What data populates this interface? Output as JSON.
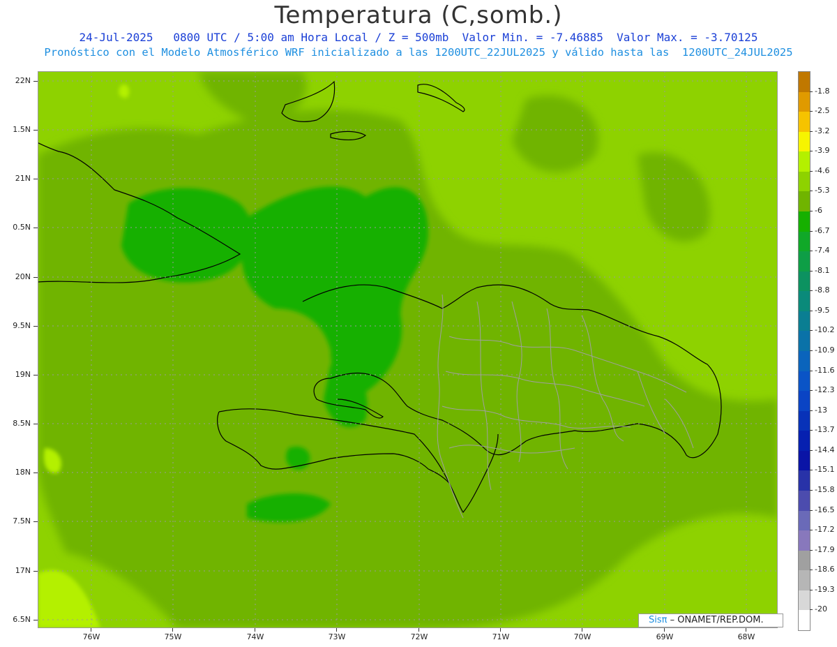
{
  "header": {
    "title": "Temperatura (C,somb.)",
    "line1": "24-Jul-2025   0800 UTC / 5:00 am Hora Local / Z = 500mb  Valor Min. = -7.46885  Valor Max. = -3.70125",
    "line2": "Pronóstico con el Modelo Atmosférico WRF inicializado a las 1200UTC_22JUL2025 y válido hasta las  1200UTC_24JUL2025"
  },
  "axes": {
    "lat_labels": [
      "22N",
      "1.5N",
      "21N",
      "0.5N",
      "20N",
      "9.5N",
      "19N",
      "8.5N",
      "18N",
      "7.5N",
      "17N",
      "6.5N"
    ],
    "lon_labels": [
      "76W",
      "75W",
      "74W",
      "73W",
      "72W",
      "71W",
      "70W",
      "69W",
      "68W"
    ]
  },
  "legend": {
    "labels": [
      "-1.8",
      "-2.5",
      "-3.2",
      "-3.9",
      "-4.6",
      "-5.3",
      "-6",
      "-6.7",
      "-7.4",
      "-8.1",
      "-8.8",
      "-9.5",
      "-10.2",
      "-10.9",
      "-11.6",
      "-12.3",
      "-13",
      "-13.7",
      "-14.4",
      "-15.1",
      "-15.8",
      "-16.5",
      "-17.2",
      "-17.9",
      "-18.6",
      "-19.3",
      "-20"
    ],
    "colors": [
      "#c07800",
      "#e09a00",
      "#f6c300",
      "#f7f400",
      "#b4f000",
      "#8ed200",
      "#70b400",
      "#16b000",
      "#10a828",
      "#0e9e46",
      "#0c9260",
      "#0a8a7a",
      "#0a7e92",
      "#0a72a8",
      "#0a64bc",
      "#0a54c6",
      "#0a44c4",
      "#0832b8",
      "#0620b0",
      "#0a14a6",
      "#2832a8",
      "#4c4cae",
      "#6a6ab8",
      "#8878bc",
      "#a0a0a0",
      "#b6b6b6",
      "#d8d8d8",
      "#ffffff"
    ]
  },
  "credit": {
    "logo_text": "Sisπ",
    "text": "– ONAMET/REP.DOM."
  },
  "map_colors": {
    "base": "#8ed200",
    "mid": "#70b400",
    "dark": "#16b000",
    "light": "#b4f000",
    "coast": "#000000",
    "provinces": "#a0a0a0"
  }
}
